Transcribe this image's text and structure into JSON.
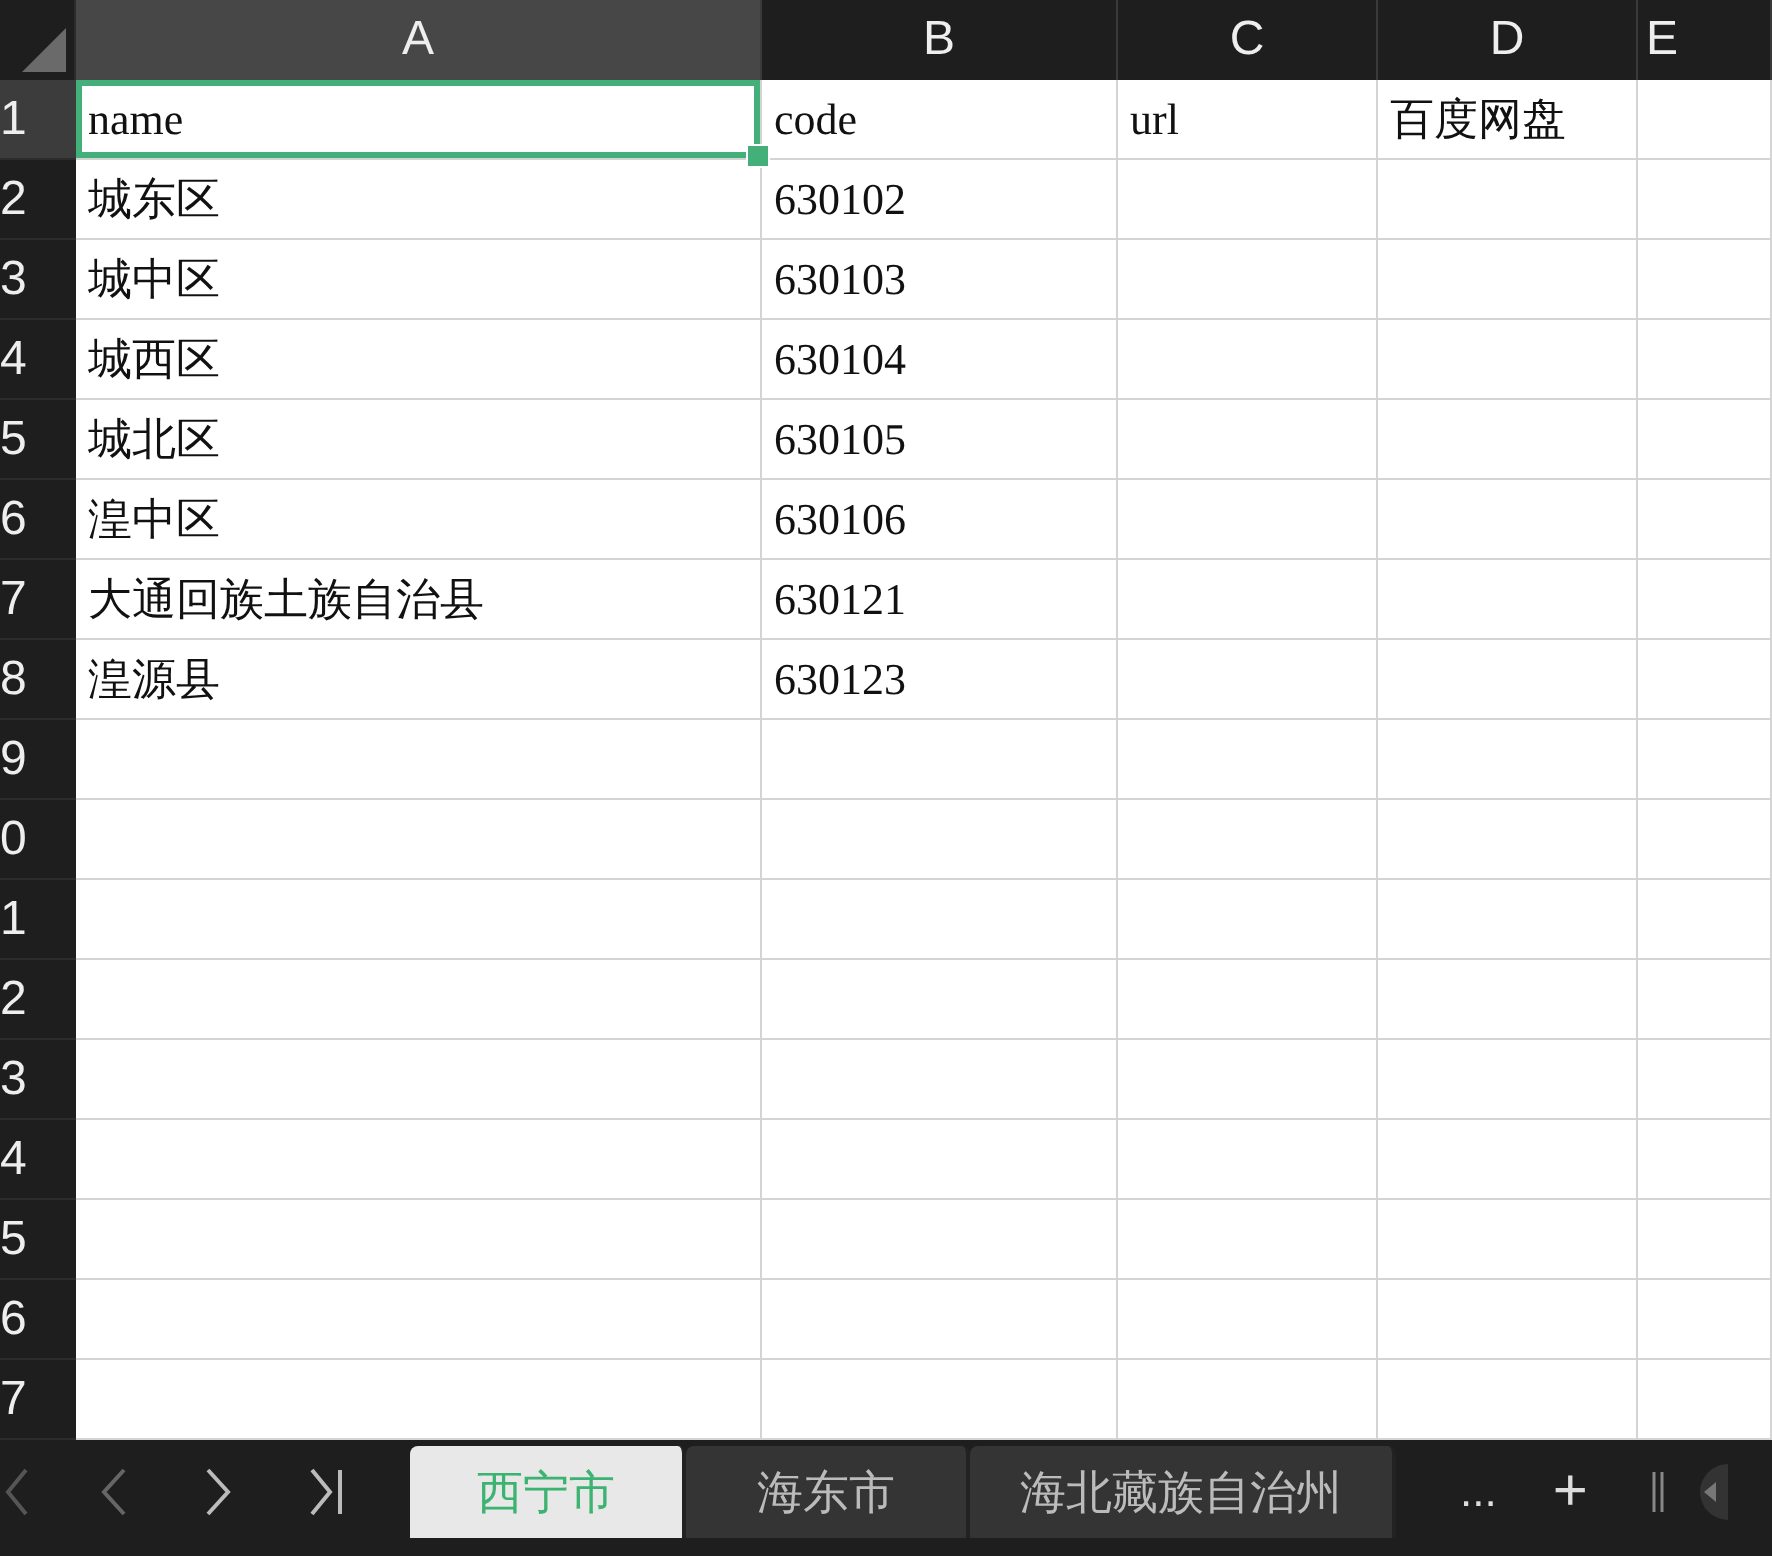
{
  "columns": [
    {
      "label": "A",
      "selected": true
    },
    {
      "label": "B",
      "selected": false
    },
    {
      "label": "C",
      "selected": false
    },
    {
      "label": "D",
      "selected": false
    },
    {
      "label": "E",
      "selected": false
    }
  ],
  "rows": [
    {
      "number": "1",
      "selected": true,
      "cells": [
        "name",
        "code",
        "url",
        "百度网盘"
      ]
    },
    {
      "number": "2",
      "selected": false,
      "cells": [
        "城东区",
        "630102"
      ]
    },
    {
      "number": "3",
      "selected": false,
      "cells": [
        "城中区",
        "630103"
      ]
    },
    {
      "number": "4",
      "selected": false,
      "cells": [
        "城西区",
        "630104"
      ]
    },
    {
      "number": "5",
      "selected": false,
      "cells": [
        "城北区",
        "630105"
      ]
    },
    {
      "number": "6",
      "selected": false,
      "cells": [
        "湟中区",
        "630106"
      ]
    },
    {
      "number": "7",
      "selected": false,
      "cells": [
        "大通回族土族自治县",
        "630121"
      ]
    },
    {
      "number": "8",
      "selected": false,
      "cells": [
        "湟源县",
        "630123"
      ]
    },
    {
      "number": "9",
      "selected": false
    },
    {
      "number": "0",
      "selected": false
    },
    {
      "number": "1",
      "selected": false
    },
    {
      "number": "2",
      "selected": false
    },
    {
      "number": "3",
      "selected": false
    },
    {
      "number": "4",
      "selected": false
    },
    {
      "number": "5",
      "selected": false
    },
    {
      "number": "6",
      "selected": false
    },
    {
      "number": "7",
      "selected": false
    }
  ],
  "sheet_tabs": [
    {
      "label": "西宁市",
      "selected": true
    },
    {
      "label": "海东市",
      "selected": false
    },
    {
      "label": "海北藏族自治州",
      "selected": false
    }
  ],
  "more_tabs": "...",
  "add_tab": "+"
}
